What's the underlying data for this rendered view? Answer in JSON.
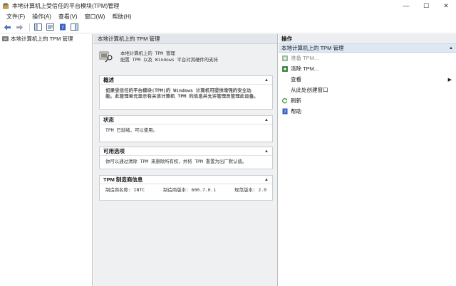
{
  "window": {
    "title": "本地计算机上受信任的平台模块(TPM)管理",
    "controls": {
      "minimize": "—",
      "maximize": "☐",
      "close": "✕"
    }
  },
  "menu": [
    "文件(F)",
    "操作(A)",
    "查看(V)",
    "窗口(W)",
    "帮助(H)"
  ],
  "toolbar": {
    "buttons": [
      "back-icon",
      "forward-icon",
      "console-tree-icon",
      "properties-icon",
      "help-icon",
      "action-pane-icon"
    ]
  },
  "tree": {
    "root_label": "本地计算机上的 TPM 管理"
  },
  "center": {
    "header": "本地计算机上的 TPM 管理",
    "intro": {
      "title": "本地计算机上的 TPM 管理",
      "subtitle": "配置 TPM 以及 Windows 平台对其硬件的支持"
    },
    "sections": {
      "overview": {
        "title": "概述",
        "line1": "如果受信任的平台模块(TPM)的 Windows 计算机可提供增强的安全功",
        "line2": "能。此管理单元显示有关该计算机 TPM 的信息并允许管理员管理此设备。"
      },
      "status": {
        "title": "状态",
        "text": "TPM 已就绪，可以使用。"
      },
      "options": {
        "title": "可用选项",
        "text": "你可以通过清除 TPM 来删除所有权，并将 TPM 重置为出厂默认值。"
      },
      "manufacturer": {
        "title": "TPM 制造商信息",
        "name": "制造商名称: INTC",
        "version": "制造商版本: 600.7.0.1",
        "spec": "规范版本: 2.0"
      }
    },
    "caret": "▲"
  },
  "actions": {
    "header": "操作",
    "subheader": "本地计算机上的 TPM 管理",
    "caret": "▲",
    "items": [
      {
        "label": "准备 TPM...",
        "icon": "green-tpm-icon",
        "disabled": true
      },
      {
        "label": "清除 TPM...",
        "icon": "green-tpm-icon",
        "disabled": false
      },
      {
        "label": "查看",
        "icon": "",
        "disabled": false,
        "submenu": "▶"
      },
      {
        "label": "从此处创建窗口",
        "icon": "",
        "disabled": false
      },
      {
        "label": "刷新",
        "icon": "refresh-icon",
        "disabled": false
      },
      {
        "label": "帮助",
        "icon": "help-book-icon",
        "disabled": false
      }
    ]
  },
  "colors": {
    "pane_bg": "#eef0f2",
    "action_highlight": "#dce8f4",
    "tpm_green": "#2e8b3a",
    "refresh_green": "#3a9a3a",
    "help_blue": "#3a5fc8"
  }
}
